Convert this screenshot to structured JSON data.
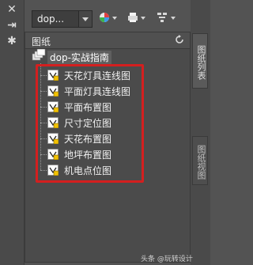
{
  "toolbar": {
    "combo_value": "dop...",
    "icons": [
      "color-wheel-icon",
      "plot-icon",
      "layout-icon"
    ]
  },
  "panel": {
    "title": "图纸",
    "root": "dop-实战指南",
    "items": [
      {
        "label": "天花灯具连线图"
      },
      {
        "label": "平面灯具连线图"
      },
      {
        "label": "平面布置图"
      },
      {
        "label": "尺寸定位图"
      },
      {
        "label": "天花布置图"
      },
      {
        "label": "地坪布置图"
      },
      {
        "label": "机电点位图"
      }
    ]
  },
  "side_tabs": [
    "图纸列表",
    "图纸视图"
  ],
  "watermark": "头条 @玩转设计",
  "colors": {
    "highlight_box": "#d41f1f",
    "panel_bg": "#4b4b4b"
  }
}
